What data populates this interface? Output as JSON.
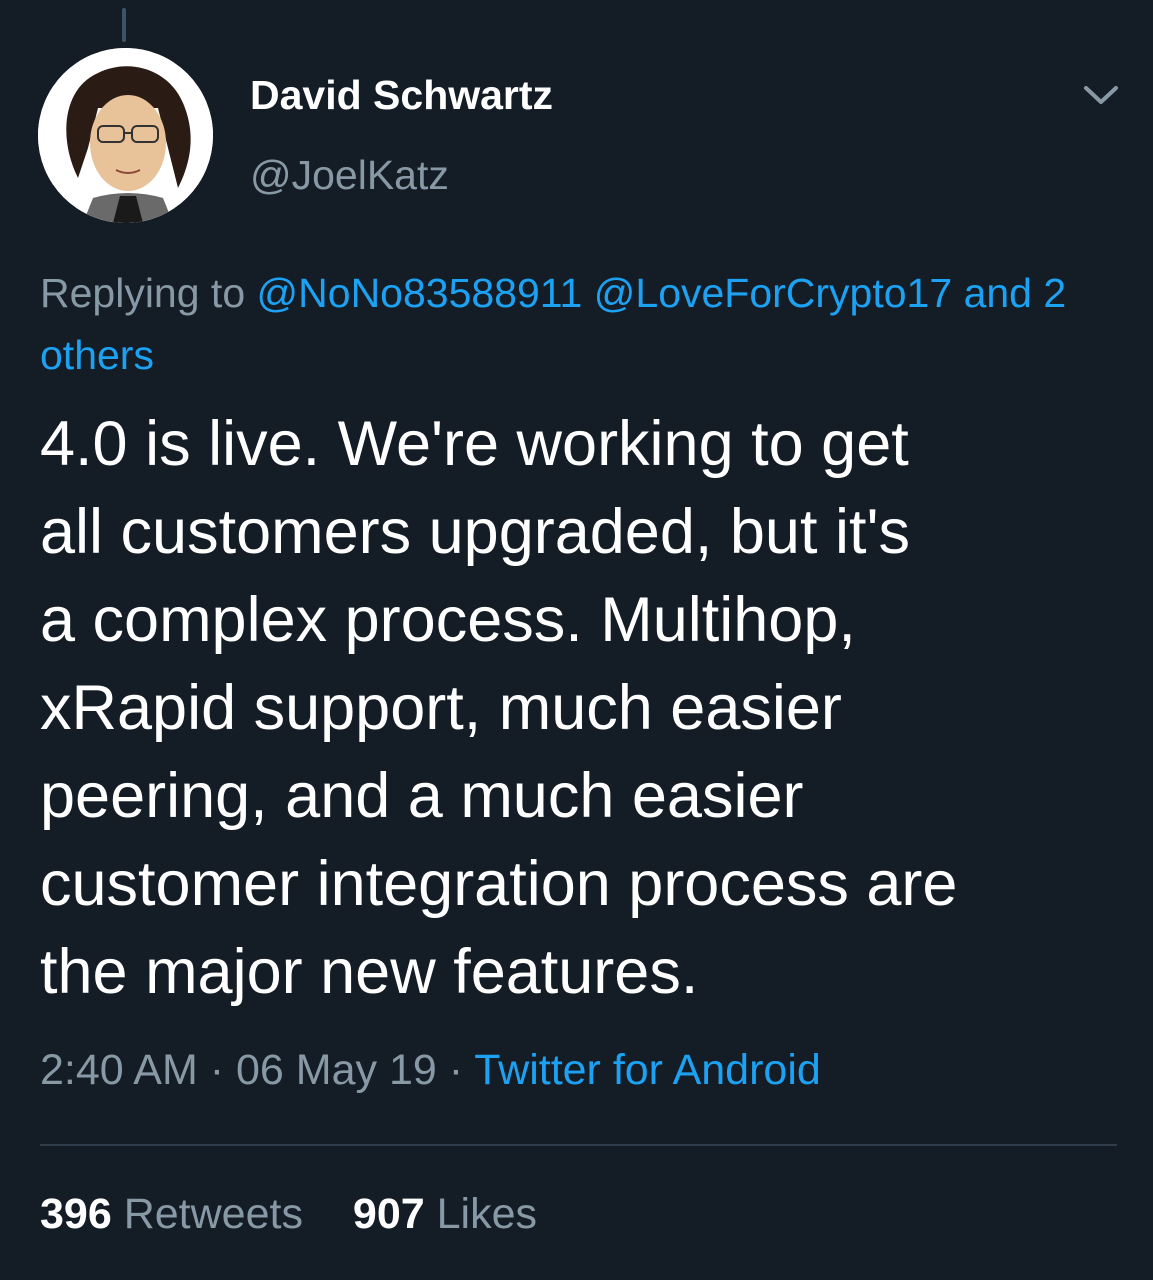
{
  "author": {
    "display_name": "David Schwartz",
    "handle": "@JoelKatz",
    "avatar_icon": "cartoon-portrait-avatar"
  },
  "reply": {
    "prefix": "Replying to",
    "mention_1": "@NoNo83588911",
    "mention_2": "@LoveForCrypto17",
    "others": "and 2 others"
  },
  "tweet": {
    "text": "4.0 is live. We're working to get\nall customers upgraded, but it's\na complex process. Multihop,\nxRapid support, much easier\npeering, and a much easier\ncustomer integration process are\nthe major new features."
  },
  "meta": {
    "time": "2:40 AM",
    "separator": "·",
    "date": "06 May 19",
    "source": "Twitter for Android"
  },
  "stats": {
    "retweets_count": "396",
    "retweets_label": "Retweets",
    "likes_count": "907",
    "likes_label": "Likes"
  },
  "colors": {
    "background": "#141d26",
    "link": "#1da1f2",
    "secondary_text": "#8899a6"
  }
}
